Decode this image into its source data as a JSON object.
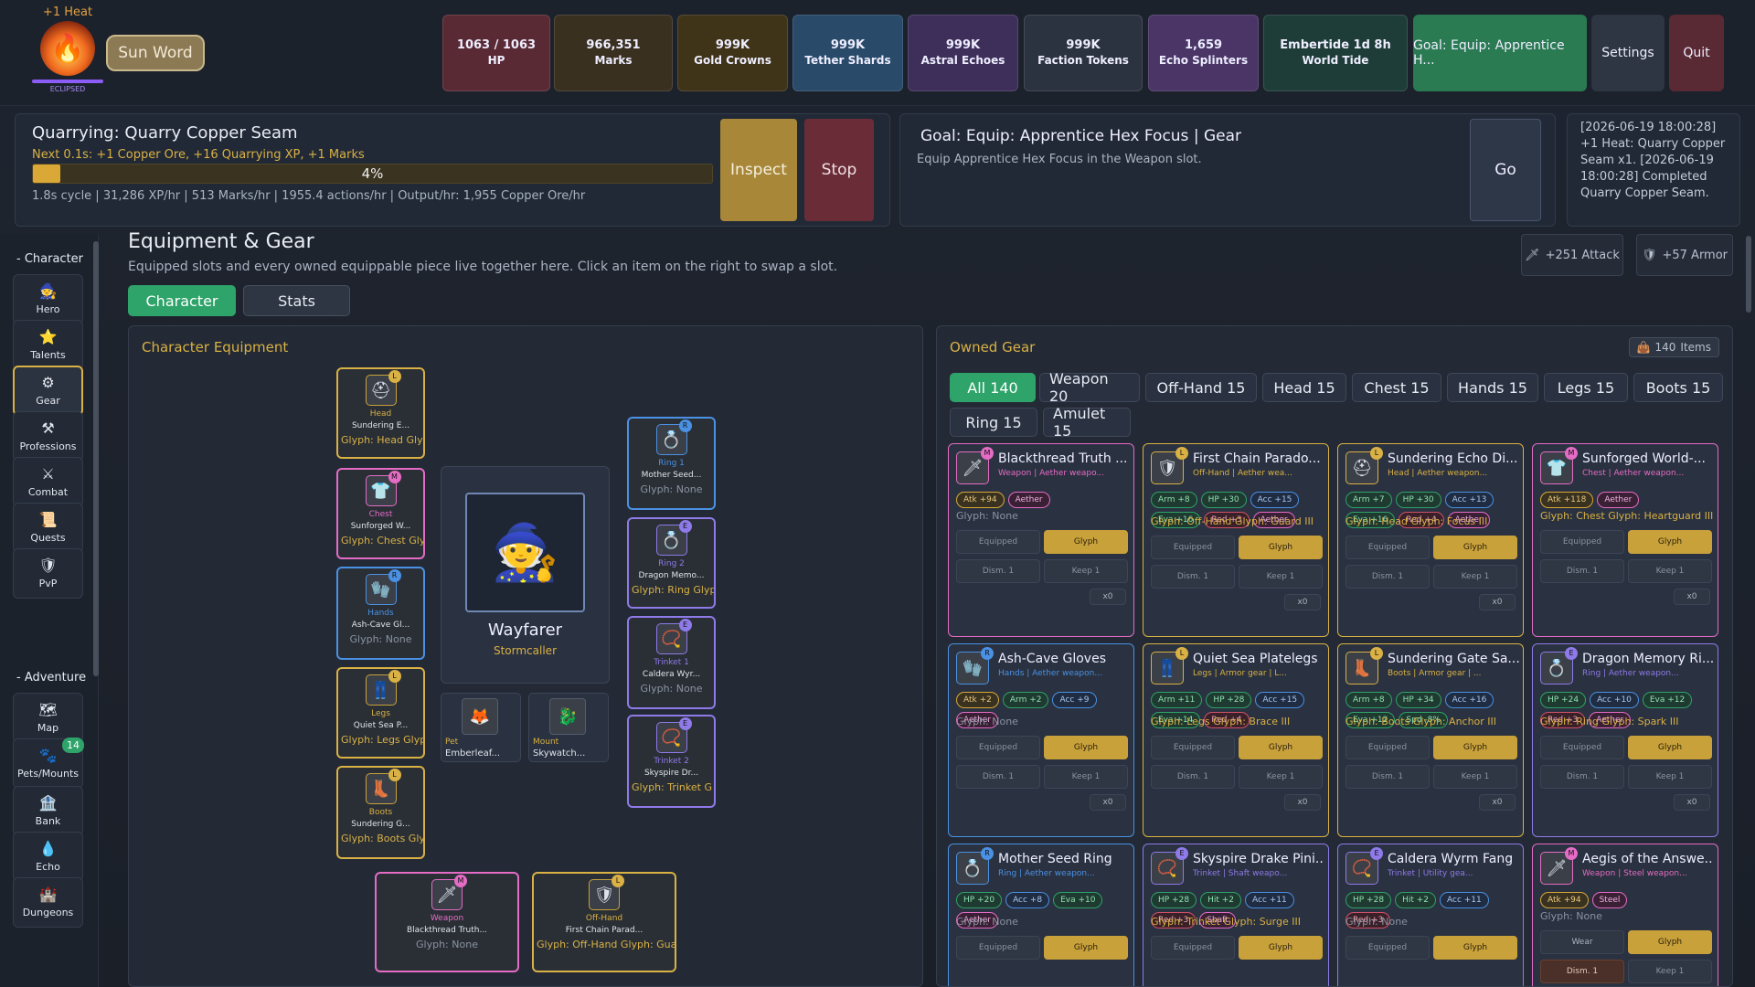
{
  "heat": {
    "label": "+1 Heat",
    "state": "ECLIPSED"
  },
  "sun_word": "Sun Word",
  "resources": [
    {
      "value": "1063 / 1063",
      "label": "HP",
      "color": "#5a2a34"
    },
    {
      "value": "966,351",
      "label": "Marks",
      "color": "#3a3020"
    },
    {
      "value": "999K",
      "label": "Gold Crowns",
      "color": "#3f3318"
    },
    {
      "value": "999K",
      "label": "Tether Shards",
      "color": "#2a4a6a"
    },
    {
      "value": "999K",
      "label": "Astral Echoes",
      "color": "#3e2f5a"
    },
    {
      "value": "999K",
      "label": "Faction Tokens",
      "color": "#2c3340"
    },
    {
      "value": "1,659",
      "label": "Echo Splinters",
      "color": "#4a3566"
    },
    {
      "value": "Embertide 1d 8h",
      "label": "World Tide",
      "color": "#1f3d38"
    }
  ],
  "top_buttons": {
    "goal": "Goal: Equip: Apprentice H...",
    "settings": "Settings",
    "quit": "Quit"
  },
  "activity": {
    "title": "Quarrying: Quarry Copper Seam",
    "next": "Next 0.1s: +1 Copper Ore, +16 Quarrying XP, +1 Marks",
    "progress_label": "4%",
    "progress": 0.04,
    "stats": "1.8s cycle | 31,286 XP/hr | 513 Marks/hr | 1955.4 actions/hr | Output/hr: 1,955 Copper Ore/hr",
    "inspect": "Inspect",
    "stop": "Stop"
  },
  "goal": {
    "title": "Goal: Equip: Apprentice Hex Focus | Gear",
    "desc": "Equip Apprentice Hex Focus in the Weapon slot.",
    "go": "Go"
  },
  "log": "[2026-06-19 18:00:28] +1 Heat: Quarry Copper Seam x1. [2026-06-19 18:00:28] Completed Quarry Copper Seam.",
  "sidebar": {
    "character_header": "- Character",
    "adventure_header": "- Adventure",
    "character_items": [
      {
        "label": "Hero",
        "icon": "🧙"
      },
      {
        "label": "Talents",
        "icon": "⭐"
      },
      {
        "label": "Gear",
        "icon": "⚙"
      },
      {
        "label": "Professions",
        "icon": "⚒"
      },
      {
        "label": "Combat",
        "icon": "⚔"
      },
      {
        "label": "Quests",
        "icon": "📜"
      },
      {
        "label": "PvP",
        "icon": "🛡"
      }
    ],
    "adventure_items": [
      {
        "label": "Map",
        "icon": "🗺"
      },
      {
        "label": "Pets/Mounts",
        "icon": "🐾",
        "badge": "14"
      },
      {
        "label": "Bank",
        "icon": "🏦"
      },
      {
        "label": "Echo",
        "icon": "💧"
      },
      {
        "label": "Dungeons",
        "icon": "🏰"
      }
    ]
  },
  "page": {
    "title": "Equipment & Gear",
    "subtitle": "Equipped slots and every owned equippable piece live together here. Click an item on the right to swap a slot.",
    "tabs": [
      "Character",
      "Stats"
    ],
    "attack_chip": "+251 Attack",
    "armor_chip": "+57 Armor"
  },
  "equipment": {
    "header": "Character Equipment",
    "hero_name": "Wayfarer",
    "hero_class": "Stormcaller",
    "slots": [
      {
        "slot": "Head",
        "rank": "L",
        "name": "Sundering E...",
        "glyph": "Glyph: Head Gly"
      },
      {
        "slot": "Chest",
        "rank": "M",
        "name": "Sunforged W...",
        "glyph": "Glyph: Chest Gly"
      },
      {
        "slot": "Hands",
        "rank": "R",
        "name": "Ash-Cave Gl...",
        "glyph": "Glyph: None"
      },
      {
        "slot": "Legs",
        "rank": "L",
        "name": "Quiet Sea P...",
        "glyph": "Glyph: Legs Glyp"
      },
      {
        "slot": "Boots",
        "rank": "L",
        "name": "Sundering G...",
        "glyph": "Glyph: Boots Gly"
      },
      {
        "slot": "Ring 1",
        "rank": "R",
        "name": "Mother Seed...",
        "glyph": "Glyph: None"
      },
      {
        "slot": "Ring 2",
        "rank": "E",
        "name": "Dragon Memo...",
        "glyph": "Glyph: Ring Glyp"
      },
      {
        "slot": "Trinket 1",
        "rank": "E",
        "name": "Caldera Wyr...",
        "glyph": "Glyph: None"
      },
      {
        "slot": "Trinket 2",
        "rank": "E",
        "name": "Skyspire Dr...",
        "glyph": "Glyph: Trinket G"
      },
      {
        "slot": "Weapon",
        "rank": "M",
        "name": "Blackthread Truth...",
        "glyph": "Glyph: None"
      },
      {
        "slot": "Off-Hand",
        "rank": "L",
        "name": "First Chain Parad...",
        "glyph": "Glyph: Off-Hand Glyph: Guard"
      }
    ],
    "pet": {
      "label": "Pet",
      "name": "Emberleaf..."
    },
    "mount": {
      "label": "Mount",
      "name": "Skywatch..."
    }
  },
  "owned": {
    "header": "Owned Gear",
    "count": "140",
    "count_unit": "Items",
    "filters": [
      "All 140",
      "Weapon 20",
      "Off-Hand 15",
      "Head 15",
      "Chest 15",
      "Hands 15",
      "Legs 15",
      "Boots 15",
      "Ring 15",
      "Amulet 15"
    ],
    "cards": [
      {
        "name": "Blackthread Truth ...",
        "rank": "M",
        "type": "Weapon | Aether weapo...",
        "tags": [
          "Atk +94",
          "Aether"
        ],
        "glyph": "Glyph: None",
        "b1": "Equipped",
        "b2": "Glyph",
        "b3": "Dism. 1",
        "b4": "Keep 1",
        "x": "x0"
      },
      {
        "name": "First Chain Parado...",
        "rank": "L",
        "type": "Off-Hand | Aether wea...",
        "tags": [
          "Arm +8",
          "HP +30",
          "Acc +15",
          "Eva +16",
          "Red +3",
          "Aether"
        ],
        "glyph": "Glyph: Off-Hand Glyph: Guard III",
        "b1": "Equipped",
        "b2": "Glyph",
        "b3": "Dism. 1",
        "b4": "Keep 1",
        "x": "x0"
      },
      {
        "name": "Sundering Echo Di...",
        "rank": "L",
        "type": "Head | Aether weapon...",
        "tags": [
          "Arm +7",
          "HP +30",
          "Acc +13",
          "Eva +16",
          "Red +4",
          "Aether"
        ],
        "glyph": "Glyph: Head Glyph: Focus III",
        "b1": "Equipped",
        "b2": "Glyph",
        "b3": "Dism. 1",
        "b4": "Keep 1",
        "x": "x0"
      },
      {
        "name": "Sunforged World-...",
        "rank": "M",
        "type": "Chest | Aether weapon...",
        "tags": [
          "Atk +118",
          "Aether"
        ],
        "glyph": "Glyph: Chest Glyph: Heartguard III",
        "b1": "Equipped",
        "b2": "Glyph",
        "b3": "Dism. 1",
        "b4": "Keep 1",
        "x": "x0"
      },
      {
        "name": "Ash-Cave Gloves",
        "rank": "R",
        "type": "Hands | Aether weapon...",
        "tags": [
          "Atk +2",
          "Arm +2",
          "Acc +9",
          "Aether"
        ],
        "glyph": "Glyph: None",
        "b1": "Equipped",
        "b2": "Glyph",
        "b3": "Dism. 1",
        "b4": "Keep 1",
        "x": "x0"
      },
      {
        "name": "Quiet Sea Platelegs",
        "rank": "L",
        "type": "Legs | Armor gear | L...",
        "tags": [
          "Arm +11",
          "HP +28",
          "Acc +15",
          "Eva +14",
          "Red +4"
        ],
        "glyph": "Glyph: Legs Glyph: Brace III",
        "b1": "Equipped",
        "b2": "Glyph",
        "b3": "Dism. 1",
        "b4": "Keep 1",
        "x": "x0"
      },
      {
        "name": "Sundering Gate Sa...",
        "rank": "L",
        "type": "Boots | Armor gear | ...",
        "tags": [
          "Arm +8",
          "HP +34",
          "Acc +16",
          "Eva +12",
          "Spd -8%"
        ],
        "glyph": "Glyph: Boots Glyph: Anchor III",
        "b1": "Equipped",
        "b2": "Glyph",
        "b3": "Dism. 1",
        "b4": "Keep 1",
        "x": "x0"
      },
      {
        "name": "Dragon Memory Ri...",
        "rank": "E",
        "type": "Ring | Aether weapon...",
        "tags": [
          "HP +24",
          "Acc +10",
          "Eva +12",
          "Red +3",
          "Aether"
        ],
        "glyph": "Glyph: Ring Glyph: Spark III",
        "b1": "Equipped",
        "b2": "Glyph",
        "b3": "Dism. 1",
        "b4": "Keep 1",
        "x": "x0"
      },
      {
        "name": "Mother Seed Ring",
        "rank": "R",
        "type": "Ring | Aether weapon...",
        "tags": [
          "HP +20",
          "Acc +8",
          "Eva +10",
          "Aether"
        ],
        "glyph": "Glyph: None",
        "b1": "Equipped",
        "b2": "Glyph",
        "b3": "",
        "b4": "",
        "x": ""
      },
      {
        "name": "Skyspire Drake Pini...",
        "rank": "E",
        "type": "Trinket | Shaft weapo...",
        "tags": [
          "HP +28",
          "Hit +2",
          "Acc +11",
          "Red +3",
          "Shaft"
        ],
        "glyph": "Glyph: Trinket Glyph: Surge III",
        "b1": "Equipped",
        "b2": "Glyph",
        "b3": "",
        "b4": "",
        "x": ""
      },
      {
        "name": "Caldera Wyrm Fang",
        "rank": "E",
        "type": "Trinket | Utility gea...",
        "tags": [
          "HP +28",
          "Hit +2",
          "Acc +11",
          "Red +3"
        ],
        "glyph": "Glyph: None",
        "b1": "Equipped",
        "b2": "Glyph",
        "b3": "",
        "b4": "",
        "x": ""
      },
      {
        "name": "Aegis of the Answe...",
        "rank": "M",
        "type": "Weapon | Steel weapon...",
        "tags": [
          "Atk +94",
          "Steel"
        ],
        "glyph": "Glyph: None",
        "b1": "Wear",
        "b2": "Glyph",
        "b3": "Dism. 1",
        "b4": "Keep 1",
        "x": ""
      }
    ]
  }
}
